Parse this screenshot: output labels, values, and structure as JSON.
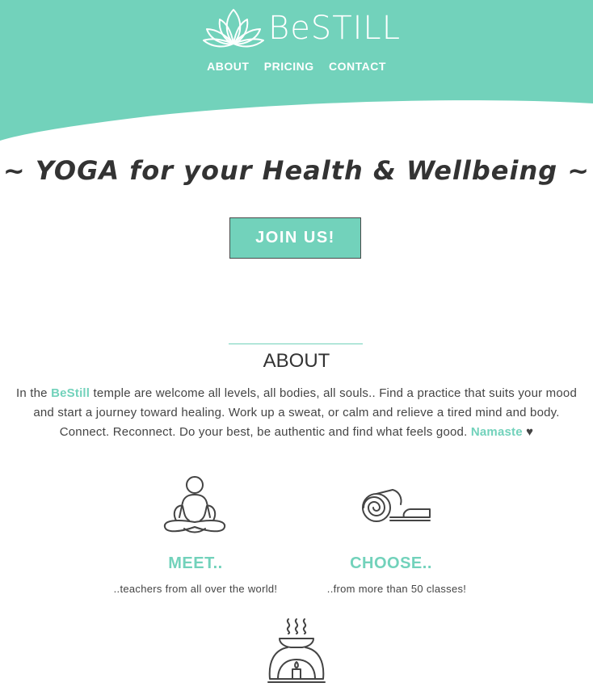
{
  "brand": {
    "name": "BeSTILL",
    "accent_color": "#72d2bb",
    "logo_icon": "lotus-icon"
  },
  "nav": {
    "items": [
      "ABOUT",
      "PRICING",
      "CONTACT"
    ]
  },
  "hero": {
    "tagline": "~ YOGA for your Health & Wellbeing ~",
    "cta_label": "JOIN US!"
  },
  "about": {
    "heading": "ABOUT",
    "text_part1": "In the ",
    "brand_inline": "BeStill",
    "text_part2": " temple are welcome all levels, all bodies, all souls.. Find a practice that suits your mood and start a journey toward healing. Work up a sweat, or calm and relieve a tired mind and body. Connect. Reconnect. Do your best, be authentic and find what feels good. ",
    "namaste": "Namaste",
    "heart": "♥"
  },
  "features": [
    {
      "icon": "meditation-person-icon",
      "title": "MEET..",
      "desc": "..teachers from all over the world!"
    },
    {
      "icon": "yoga-mat-icon",
      "title": "CHOOSE..",
      "desc": "..from more than 50 classes!"
    },
    {
      "icon": "oil-burner-icon",
      "title": "",
      "desc": ""
    }
  ]
}
